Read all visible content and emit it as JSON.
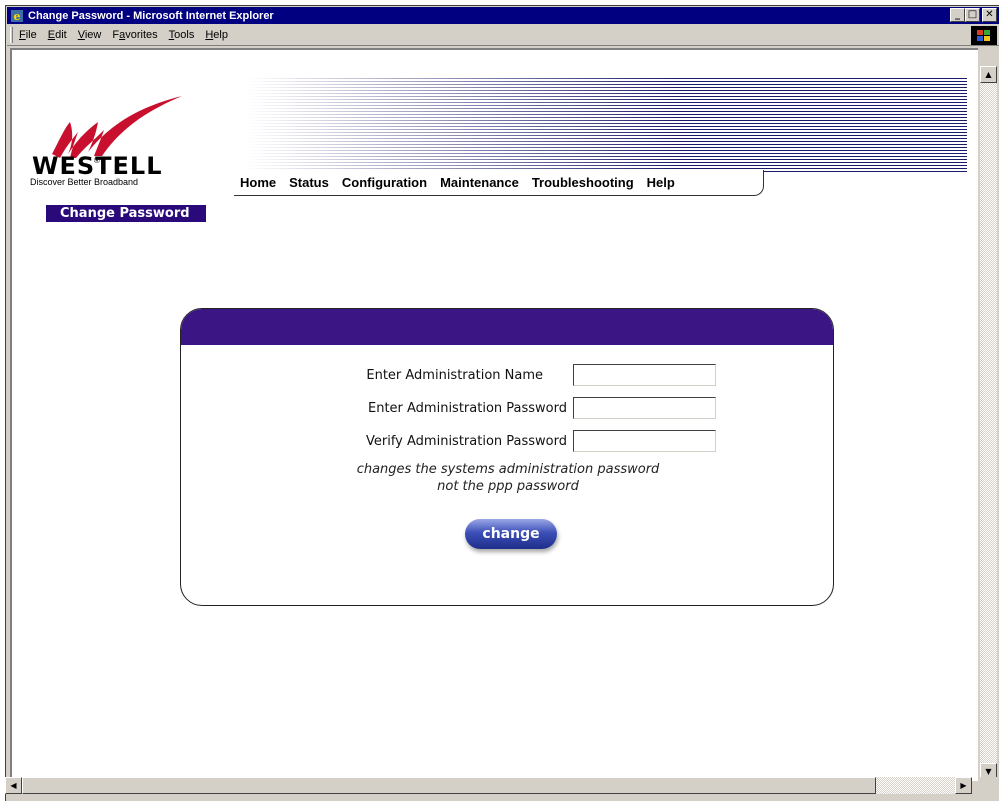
{
  "window": {
    "title": "Change Password - Microsoft Internet Explorer",
    "minimize": "_",
    "maximize": "□",
    "close": "✕"
  },
  "menu": [
    {
      "label": "File",
      "key": "F"
    },
    {
      "label": "Edit",
      "key": "E"
    },
    {
      "label": "View",
      "key": "V"
    },
    {
      "label": "Favorites",
      "key": "a"
    },
    {
      "label": "Tools",
      "key": "T"
    },
    {
      "label": "Help",
      "key": "H"
    }
  ],
  "brand": {
    "name": "WESTELL",
    "tagline": "Discover Better Broadband",
    "registered": "®"
  },
  "nav": [
    "Home",
    "Status",
    "Configuration",
    "Maintenance",
    "Troubleshooting",
    "Help"
  ],
  "page_tab": "Change Password",
  "form": {
    "name_label": "Enter Administration Name",
    "name_value": "",
    "password_label": "Enter Administration Password",
    "password_value": "",
    "verify_label": "Verify Administration Password",
    "verify_value": "",
    "note_line1": "changes the systems administration password",
    "note_line2": "not the ppp password",
    "submit_label": "change"
  },
  "colors": {
    "titlebar": "#000080",
    "accent": "#3c1585",
    "tab": "#2a0a7a"
  },
  "icons": {
    "app": "ie-page-icon",
    "brand": "windows-flag-icon",
    "scroll_up": "▲",
    "scroll_down": "▼",
    "scroll_left": "◀",
    "scroll_right": "▶"
  }
}
